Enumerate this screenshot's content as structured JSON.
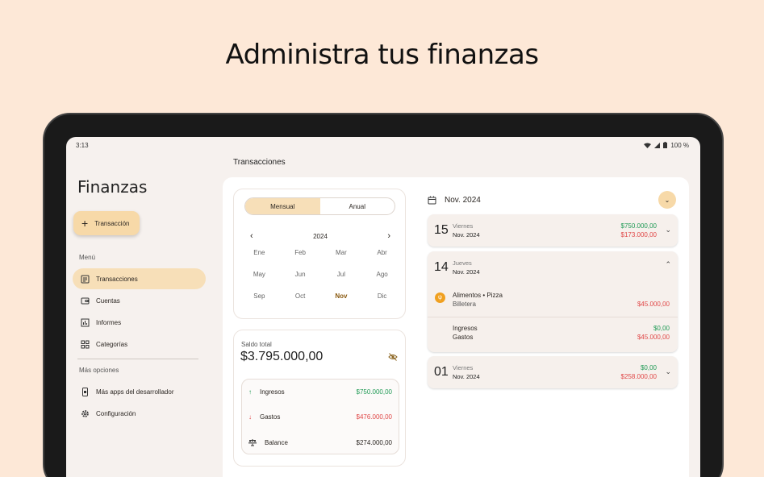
{
  "headline": "Administra tus finanzas",
  "status": {
    "time": "3:13",
    "battery": "100 %"
  },
  "app_title": "Finanzas",
  "fab_label": "Transacción",
  "menu_label": "Menú",
  "nav": [
    "Transacciones",
    "Cuentas",
    "Informes",
    "Categorías"
  ],
  "more_label": "Más opciones",
  "more": [
    "Más apps del desarrollador",
    "Configuración"
  ],
  "page_title": "Transacciones",
  "calendar": {
    "tabs": [
      "Mensual",
      "Anual"
    ],
    "year": "2024",
    "months": [
      "Ene",
      "Feb",
      "Mar",
      "Abr",
      "May",
      "Jun",
      "Jul",
      "Ago",
      "Sep",
      "Oct",
      "Nov",
      "Dic"
    ],
    "selected_month": "Nov"
  },
  "saldo": {
    "label": "Saldo total",
    "value": "$3.795.000,00",
    "rows": [
      {
        "label": "Ingresos",
        "value": "$750.000,00"
      },
      {
        "label": "Gastos",
        "value": "$476.000,00"
      },
      {
        "label": "Balance",
        "value": "$274.000,00"
      }
    ]
  },
  "current_month": "Nov. 2024",
  "days": [
    {
      "day": "15",
      "weekday": "Viernes",
      "month": "Nov. 2024",
      "income": "$750.000,00",
      "expense": "$173.000,00"
    },
    {
      "day": "14",
      "weekday": "Jueves",
      "month": "Nov. 2024",
      "transaction": {
        "title": "Alimentos • Pizza",
        "account": "Billetera",
        "amount": "$45.000,00"
      },
      "summary": {
        "income_label": "Ingresos",
        "income": "$0,00",
        "expense_label": "Gastos",
        "expense": "$45.000,00"
      }
    },
    {
      "day": "01",
      "weekday": "Viernes",
      "month": "Nov. 2024",
      "income": "$0,00",
      "expense": "$258.000,00"
    }
  ],
  "colors": {
    "accent": "#f7dfb8",
    "income": "#1f9a55",
    "expense": "#e04848",
    "background": "#fde8d7"
  }
}
